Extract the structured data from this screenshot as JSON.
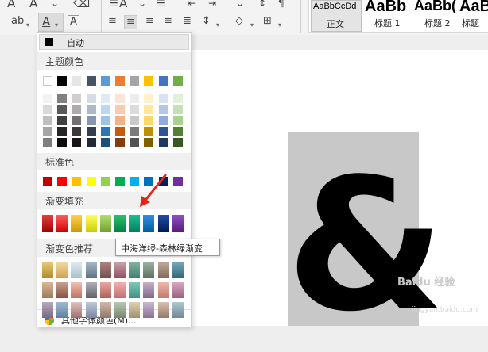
{
  "toolbar": {
    "row1_icons": [
      "A",
      "A",
      "change-case-icon",
      "clear-format-icon",
      "A",
      "A",
      "list-bullets-icon",
      "list-numbers-icon",
      "indent-icon",
      "outdent-icon",
      "text-direction-icon",
      "sort-icon",
      "show-marks-icon"
    ],
    "row2": {
      "highlight_glyph": "ab",
      "font_color_glyph": "A",
      "char_shading_glyph": "A"
    },
    "styles": [
      {
        "preview": "AaBbCcDd",
        "label": "正文"
      },
      {
        "preview": "AaBb",
        "label": "标题 1"
      },
      {
        "preview": "AaBb(",
        "label": "标题 2"
      },
      {
        "preview": "AaB",
        "label": "标题"
      }
    ]
  },
  "palette": {
    "auto_label": "自动",
    "theme_title": "主题颜色",
    "standard_title": "标准色",
    "gradient_title": "渐变填充",
    "gradient_recommend_title": "渐变色推荐",
    "more_label": "其他字体颜色(M)...",
    "theme_top": [
      "#ffffff",
      "#000000",
      "#e7e6e6",
      "#44546a",
      "#5b9bd5",
      "#ed7d31",
      "#a5a5a5",
      "#ffc000",
      "#4472c4",
      "#70ad47"
    ],
    "theme_shades": [
      [
        "#f2f2f2",
        "#808080",
        "#d0cece",
        "#d6dce5",
        "#deebf7",
        "#fbe5d6",
        "#ededed",
        "#fff2cc",
        "#dae3f3",
        "#e2f0d9"
      ],
      [
        "#d9d9d9",
        "#595959",
        "#aeabab",
        "#adb9ca",
        "#bdd7ee",
        "#f8cbad",
        "#dbdbdb",
        "#ffe699",
        "#b4c7e7",
        "#c5e0b4"
      ],
      [
        "#bfbfbf",
        "#404040",
        "#767171",
        "#8497b0",
        "#9dc3e6",
        "#f4b183",
        "#c9c9c9",
        "#ffd966",
        "#8faadc",
        "#a9d18e"
      ],
      [
        "#a6a6a6",
        "#262626",
        "#3b3838",
        "#333f50",
        "#2e75b6",
        "#c55a11",
        "#7b7b7b",
        "#bf9000",
        "#2f5597",
        "#548235"
      ],
      [
        "#7f7f7f",
        "#0d0d0d",
        "#171515",
        "#222a35",
        "#1f4e79",
        "#843c0c",
        "#525252",
        "#7f6000",
        "#203864",
        "#385723"
      ]
    ],
    "standard": [
      "#c00000",
      "#ff0000",
      "#ffc000",
      "#ffff00",
      "#92d050",
      "#00b050",
      "#00b0f0",
      "#0070c0",
      "#002060",
      "#7030a0"
    ],
    "gradients": [
      [
        "#e04040",
        "#a00000"
      ],
      [
        "#ff6060",
        "#cc0000"
      ],
      [
        "#ffd24d",
        "#cc9900"
      ],
      [
        "#ffff66",
        "#cccc00"
      ],
      [
        "#b0e070",
        "#70a030"
      ],
      [
        "#30c070",
        "#008040"
      ],
      [
        "#1fbf8f",
        "#008060"
      ],
      [
        "#3090e0",
        "#005aa0"
      ],
      [
        "#2050a0",
        "#001850"
      ],
      [
        "#9050c0",
        "#5a1a80"
      ]
    ],
    "recommend": [
      [
        [
          "#e8c870",
          "#b08830"
        ],
        [
          "#f0d8a0",
          "#d0a050"
        ],
        [
          "#e0e8f0",
          "#a8c0c8"
        ],
        [
          "#a0b8c8",
          "#607080"
        ],
        [
          "#b08080",
          "#705050"
        ],
        [
          "#c8a0a8",
          "#905060"
        ],
        [
          "#80b0a0",
          "#408070"
        ],
        [
          "#98b0a0",
          "#607060"
        ],
        [
          "#c0a898",
          "#806858"
        ],
        [
          "#70a8b8",
          "#306878"
        ]
      ],
      [
        [
          "#d8b898",
          "#a07858"
        ],
        [
          "#c8a090",
          "#885040"
        ],
        [
          "#f0c0b0",
          "#c07060"
        ],
        [
          "#b0b0b8",
          "#606068"
        ],
        [
          "#e8a8a0",
          "#b06058"
        ],
        [
          "#f0b0b0",
          "#c07070"
        ],
        [
          "#80c8b8",
          "#409080"
        ],
        [
          "#c8b0c8",
          "#806888"
        ],
        [
          "#f0b8a8",
          "#c07868"
        ],
        [
          "#d8a8c0",
          "#986080"
        ]
      ],
      [
        [
          "#b8a8c0",
          "#786880"
        ],
        [
          "#a0b8d0",
          "#6080a0"
        ],
        [
          "#e0c0c0",
          "#a07070"
        ],
        [
          "#c0c8d8",
          "#7888a0"
        ],
        [
          "#d0b8a8",
          "#907868"
        ],
        [
          "#b8c8b0",
          "#788870"
        ],
        [
          "#e0d0b0",
          "#a09070"
        ],
        [
          "#c8b8d0",
          "#887098"
        ],
        [
          "#d8c0b0",
          "#987868"
        ],
        [
          "#b0c8d0",
          "#708898"
        ]
      ]
    ],
    "tooltip_text": "中海洋绿-森林绿渐变"
  },
  "watermark": {
    "text": "Baidu 经验",
    "url": "jingyan.baidu.com"
  },
  "document": {
    "glyph": "&"
  },
  "colors": {
    "arrow": "#e8231b"
  }
}
